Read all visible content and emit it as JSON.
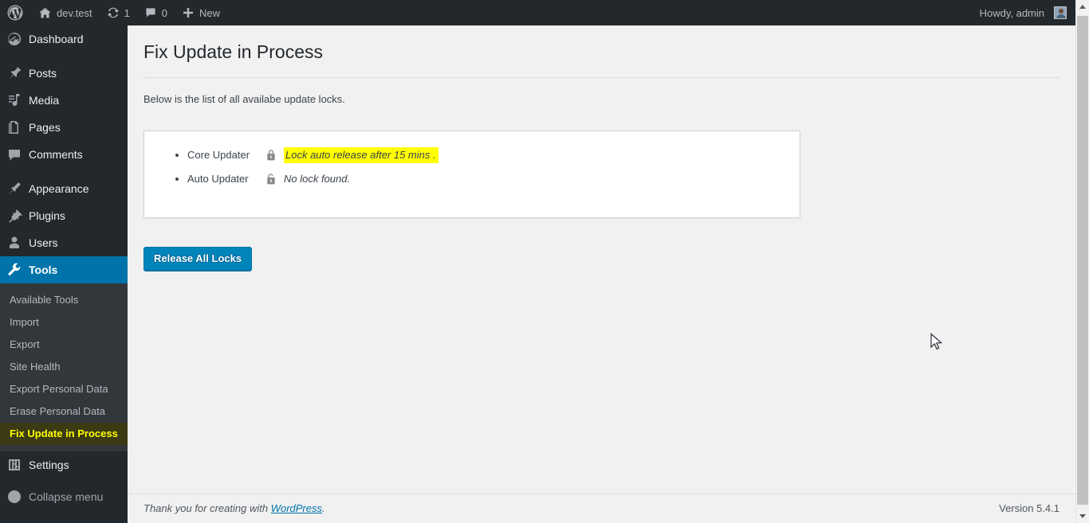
{
  "adminbar": {
    "logo_icon": "wordpress-logo-icon",
    "site_name": "dev.test",
    "site_home_icon": "home-icon",
    "updates_icon": "updates-icon",
    "updates_count": "1",
    "comments_icon": "comments-bubble-icon",
    "comments_count": "0",
    "new_icon": "plus-icon",
    "new_label": "New",
    "howdy": "Howdy, admin",
    "avatar_icon": "avatar"
  },
  "sidebar": {
    "items": [
      {
        "label": "Dashboard",
        "icon": "dashboard-icon",
        "current": false
      },
      {
        "label": "Posts",
        "icon": "posts-pin-icon",
        "current": false
      },
      {
        "label": "Media",
        "icon": "media-icon",
        "current": false
      },
      {
        "label": "Pages",
        "icon": "pages-icon",
        "current": false
      },
      {
        "label": "Comments",
        "icon": "comments-bubble-icon",
        "current": false
      },
      {
        "label": "Appearance",
        "icon": "appearance-brush-icon",
        "current": false
      },
      {
        "label": "Plugins",
        "icon": "plugins-plug-icon",
        "current": false
      },
      {
        "label": "Users",
        "icon": "users-icon",
        "current": false
      },
      {
        "label": "Tools",
        "icon": "tools-wrench-icon",
        "current": true
      },
      {
        "label": "Settings",
        "icon": "settings-sliders-icon",
        "current": false
      }
    ],
    "submenu": [
      {
        "label": "Available Tools",
        "current": false
      },
      {
        "label": "Import",
        "current": false
      },
      {
        "label": "Export",
        "current": false
      },
      {
        "label": "Site Health",
        "current": false
      },
      {
        "label": "Export Personal Data",
        "current": false
      },
      {
        "label": "Erase Personal Data",
        "current": false
      },
      {
        "label": "Fix Update in Process",
        "current": true
      }
    ],
    "collapse": {
      "label": "Collapse menu",
      "icon": "collapse-arrow-icon"
    }
  },
  "main": {
    "page_title": "Fix Update in Process",
    "description": "Below is the list of all availabe update locks.",
    "locks": [
      {
        "name": "Core Updater",
        "icon": "lock-closed-icon",
        "message": "Lock auto release after 15 mins .",
        "highlighted": true
      },
      {
        "name": "Auto Updater",
        "icon": "lock-open-icon",
        "message": "No lock found.",
        "highlighted": false
      }
    ],
    "release_button": "Release All Locks"
  },
  "footer": {
    "thanks_prefix": "Thank you for creating with ",
    "thanks_link": "WordPress",
    "thanks_suffix": ".",
    "version": "Version 5.4.1"
  },
  "colors": {
    "admin_dark": "#23282d",
    "submenu_bg": "#32373c",
    "accent_blue": "#0073aa",
    "button_blue": "#0085ba",
    "highlight_yellow": "#ffff00",
    "current_sub_bg": "#3b3a13",
    "current_sub_text": "#ffff00",
    "content_bg": "#f1f1f1"
  }
}
